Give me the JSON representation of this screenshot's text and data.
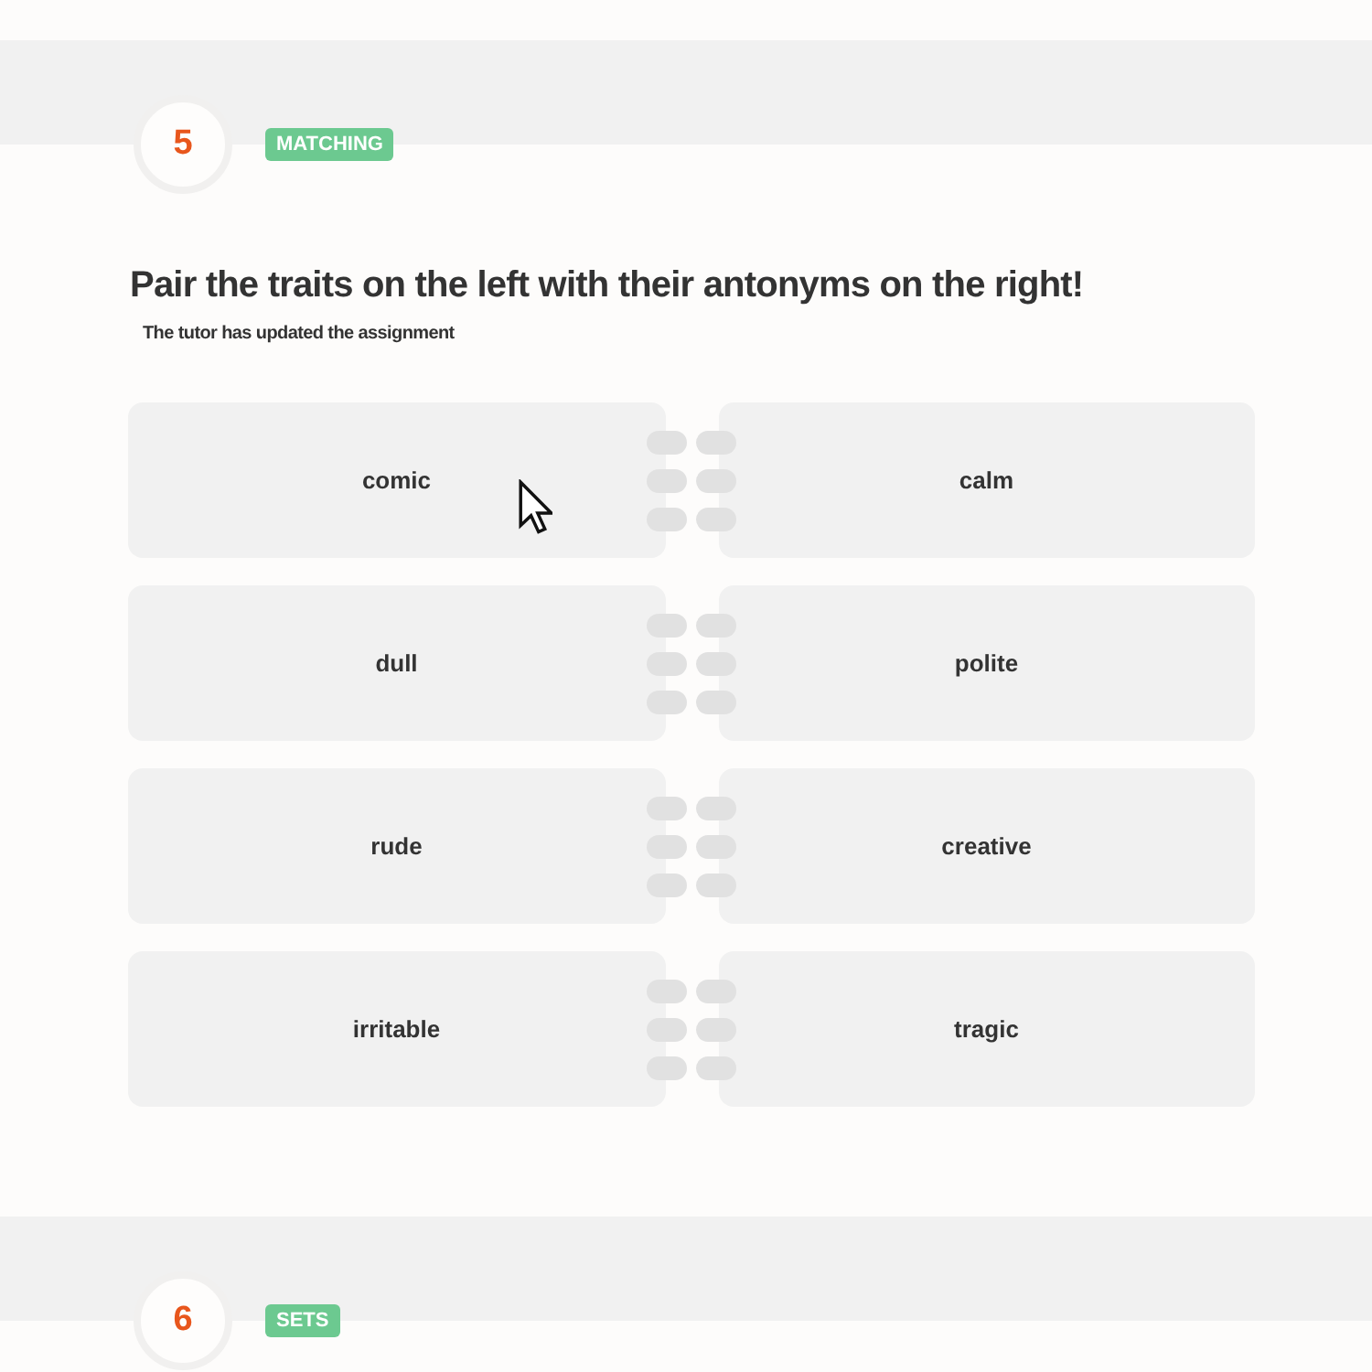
{
  "questions": [
    {
      "number": "5",
      "badge": "MATCHING",
      "title": "Pair the traits on the left with their antonyms on the right!",
      "subtitle": "The tutor has updated the assignment",
      "pairs": [
        {
          "left": "comic",
          "right": "calm"
        },
        {
          "left": "dull",
          "right": "polite"
        },
        {
          "left": "rude",
          "right": "creative"
        },
        {
          "left": "irritable",
          "right": "tragic"
        }
      ]
    },
    {
      "number": "6",
      "badge": "SETS"
    }
  ]
}
